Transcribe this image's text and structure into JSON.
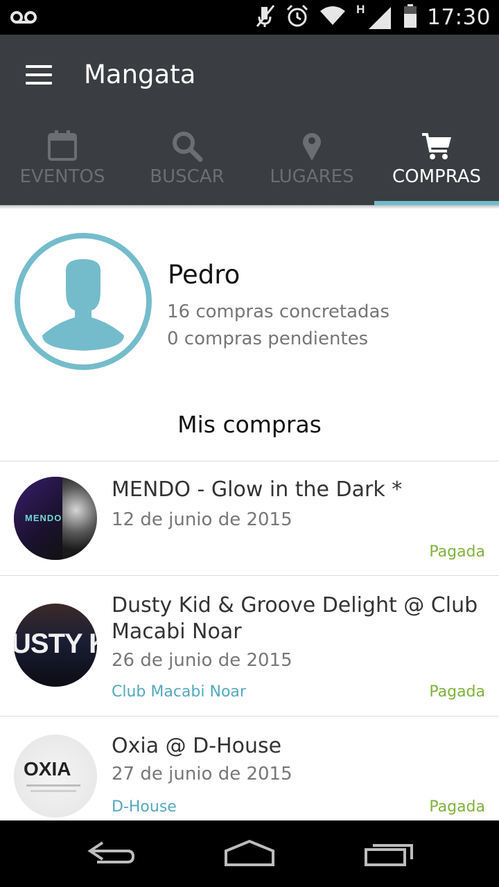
{
  "status_bar": {
    "time": "17:30",
    "icons": [
      "voicemail-icon",
      "mute-icon",
      "alarm-icon",
      "wifi-icon",
      "hspa-icon",
      "signal-icon",
      "battery-icon"
    ],
    "network_label": "H"
  },
  "app_bar": {
    "title": "Mangata",
    "menu_icon": "hamburger-menu-icon"
  },
  "tabs": [
    {
      "label": "EVENTOS",
      "icon": "calendar-icon",
      "active": false
    },
    {
      "label": "BUSCAR",
      "icon": "search-icon",
      "active": false
    },
    {
      "label": "LUGARES",
      "icon": "map-pin-icon",
      "active": false
    },
    {
      "label": "COMPRAS",
      "icon": "shopping-cart-icon",
      "active": true
    }
  ],
  "profile": {
    "name": "Pedro",
    "completed": "16 compras concretadas",
    "pending": "0 compras pendientes"
  },
  "section_title": "Mis compras",
  "purchases": [
    {
      "title": "MENDO - Glow in the Dark *",
      "date": "12 de junio de 2015",
      "venue": "",
      "status": "Pagada",
      "thumb_text": "MENDO"
    },
    {
      "title": "Dusty Kid & Groove Delight @ Club Macabi Noar",
      "date": "26 de junio de 2015",
      "venue": "Club Macabi Noar",
      "status": "Pagada",
      "thumb_text": "USTY K"
    },
    {
      "title": "Oxia @ D-House",
      "date": "27 de junio de 2015",
      "venue": "D-House",
      "status": "Pagada",
      "thumb_text": "OXIA"
    }
  ],
  "colors": {
    "appbar": "#3a3d41",
    "accent": "#6fbccb",
    "paid": "#7fb23c",
    "venue": "#52a9bd"
  },
  "nav_bar": {
    "buttons": [
      "back-icon",
      "home-icon",
      "recents-icon"
    ]
  }
}
